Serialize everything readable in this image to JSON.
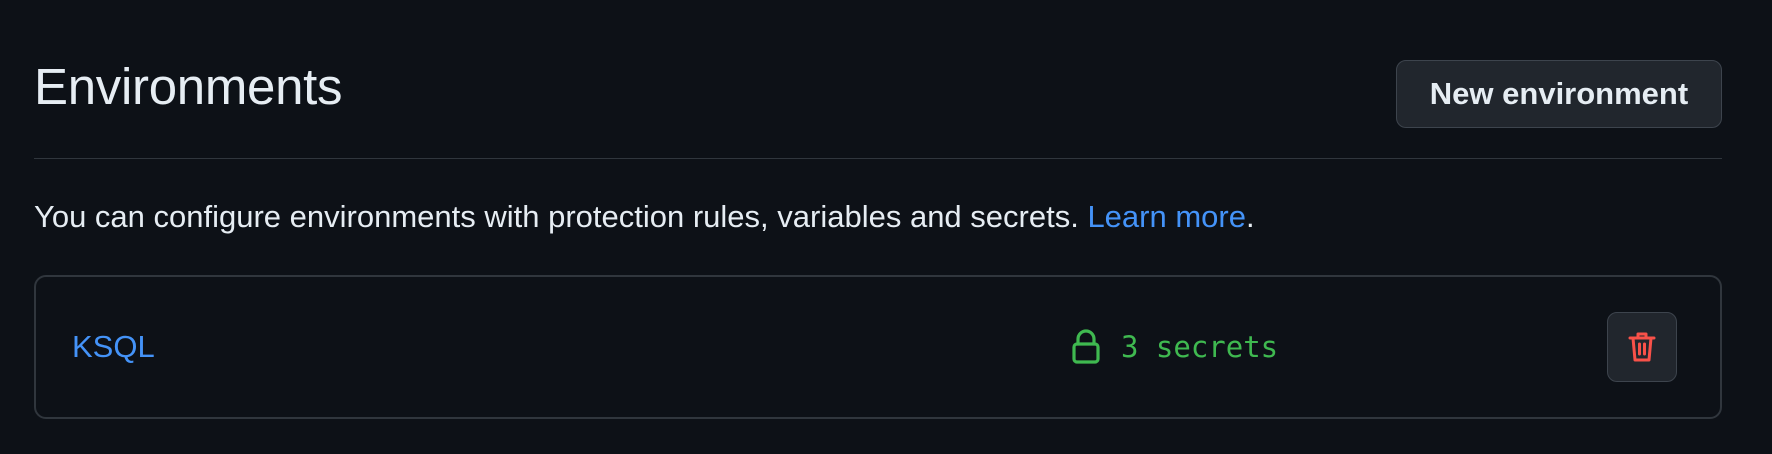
{
  "header": {
    "title": "Environments",
    "new_environment_label": "New environment"
  },
  "description": {
    "text": "You can configure environments with protection rules, variables and secrets. ",
    "link_label": "Learn more",
    "trailing": "."
  },
  "environments": [
    {
      "name": "KSQL",
      "secrets_label": "3 secrets",
      "secrets_icon": "lock-icon",
      "delete_icon": "trash-icon"
    }
  ],
  "colors": {
    "background": "#0d1117",
    "link": "#4493f8",
    "success": "#3fb950",
    "danger": "#f85149",
    "border": "#30363d"
  }
}
